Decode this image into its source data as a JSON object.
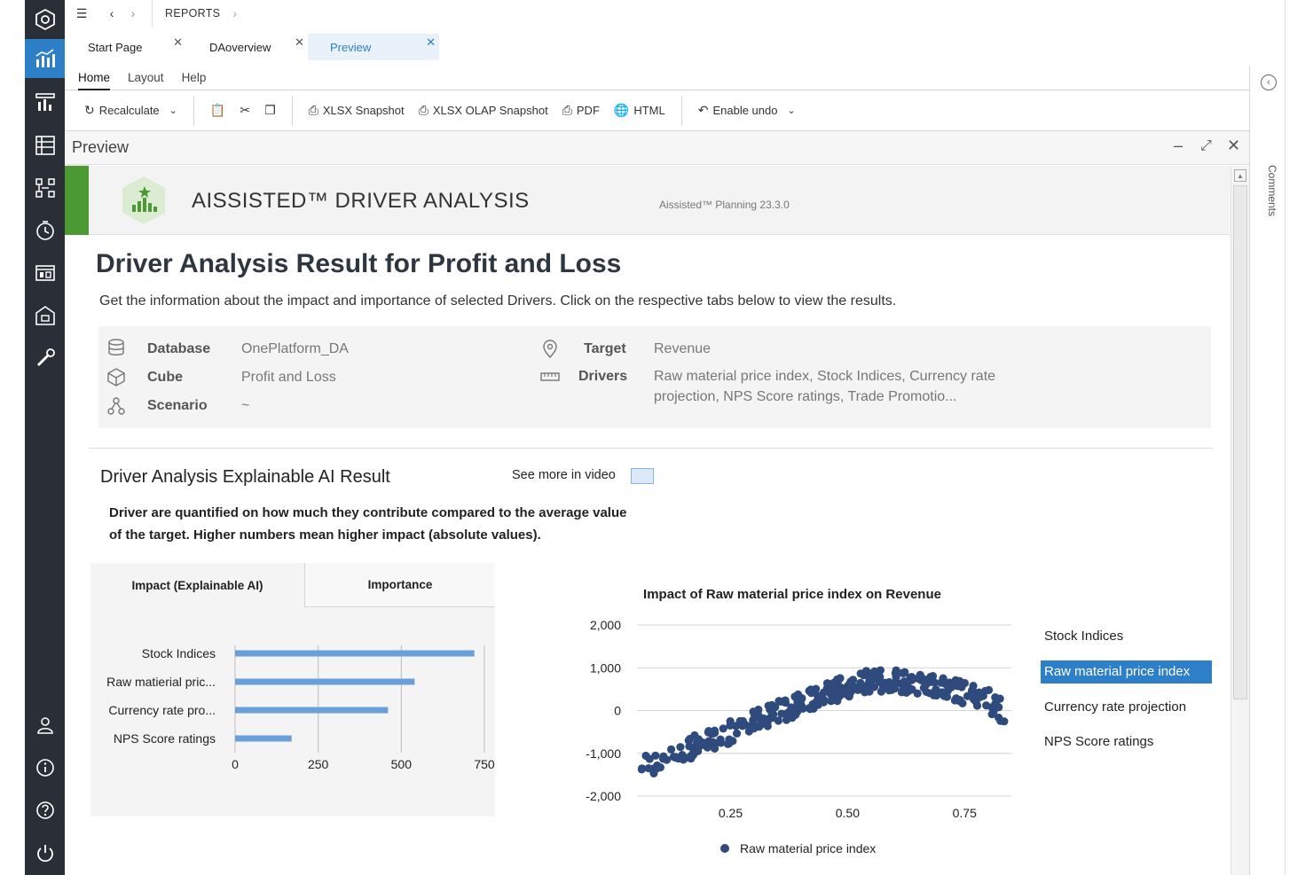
{
  "topbar": {
    "breadcrumb": "REPORTS"
  },
  "doc_tabs": [
    {
      "label": "Start Page",
      "active": false
    },
    {
      "label": "DAoverview",
      "active": false
    },
    {
      "label": "Preview",
      "active": true
    }
  ],
  "ribbon_tabs": [
    "Home",
    "Layout",
    "Help"
  ],
  "toolbar": {
    "recalculate": "Recalculate",
    "xlsx_snapshot": "XLSX Snapshot",
    "xlsx_olap_snapshot": "XLSX OLAP Snapshot",
    "pdf": "PDF",
    "html": "HTML",
    "enable_undo": "Enable undo"
  },
  "comments_label": "Comments",
  "panel": {
    "title": "Preview"
  },
  "banner": {
    "title": "AISSISTED™ DRIVER ANALYSIS",
    "version": "Aissisted™ Planning 23.3.0"
  },
  "main": {
    "heading": "Driver Analysis Result for Profit and Loss",
    "description": "Get the information about the impact and importance of selected Drivers. Click on the respective tabs below to view the results."
  },
  "info": {
    "database_label": "Database",
    "database_value": "OnePlatform_DA",
    "cube_label": "Cube",
    "cube_value": "Profit and Loss",
    "scenario_label": "Scenario",
    "scenario_value": "~",
    "target_label": "Target",
    "target_value": "Revenue",
    "drivers_label": "Drivers",
    "drivers_value_line1": "Raw material price index, Stock Indices, Currency rate",
    "drivers_value_line2": "projection, NPS Score ratings, Trade Promotio..."
  },
  "xai": {
    "heading": "Driver Analysis Explainable AI Result",
    "see_more": "See more in video",
    "explanation_line1": "Driver are quantified on how much they contribute compared to the average value",
    "explanation_line2": "of the target. Higher numbers mean higher impact (absolute values).",
    "tab_impact": "Impact (Explainable AI)",
    "tab_importance": "Importance"
  },
  "drivers_list": [
    {
      "label": "Stock Indices",
      "selected": false
    },
    {
      "label": "Raw material price index",
      "selected": true
    },
    {
      "label": "Currency rate projection",
      "selected": false
    },
    {
      "label": "NPS Score ratings",
      "selected": false
    }
  ],
  "colors": {
    "accent": "#2d7fc8",
    "bar": "#6a9fdb",
    "scatter": "#2f4a7c",
    "banner_green": "#4b9a34",
    "rail": "#2a2f37"
  },
  "chart_data": [
    {
      "type": "bar",
      "orientation": "horizontal",
      "categories": [
        "Stock Indices",
        "Raw matierial pric...",
        "Currency rate pro...",
        "NPS Score ratings"
      ],
      "values": [
        720,
        540,
        460,
        170
      ],
      "xlim": [
        0,
        750
      ],
      "xticks": [
        "0",
        "250",
        "500",
        "750"
      ],
      "grid": "vertical"
    },
    {
      "type": "scatter",
      "title": "Impact of Raw material price index on Revenue",
      "series": [
        {
          "name": "Raw material price index"
        }
      ],
      "xlim": [
        0.05,
        0.85
      ],
      "ylim": [
        -2000,
        2000
      ],
      "xticks": [
        "0.25",
        "0.50",
        "0.75"
      ],
      "yticks": [
        "2,000",
        "1,000",
        "0",
        "-1,000",
        "-2,000"
      ],
      "trend": [
        [
          0.06,
          -1350
        ],
        [
          0.1,
          -1150
        ],
        [
          0.15,
          -950
        ],
        [
          0.2,
          -700
        ],
        [
          0.25,
          -500
        ],
        [
          0.3,
          -250
        ],
        [
          0.35,
          -50
        ],
        [
          0.4,
          150
        ],
        [
          0.45,
          400
        ],
        [
          0.5,
          550
        ],
        [
          0.55,
          700
        ],
        [
          0.6,
          700
        ],
        [
          0.65,
          650
        ],
        [
          0.7,
          550
        ],
        [
          0.75,
          400
        ],
        [
          0.8,
          250
        ],
        [
          0.84,
          -100
        ]
      ],
      "grid": "horizontal",
      "legend": "bottom"
    }
  ]
}
